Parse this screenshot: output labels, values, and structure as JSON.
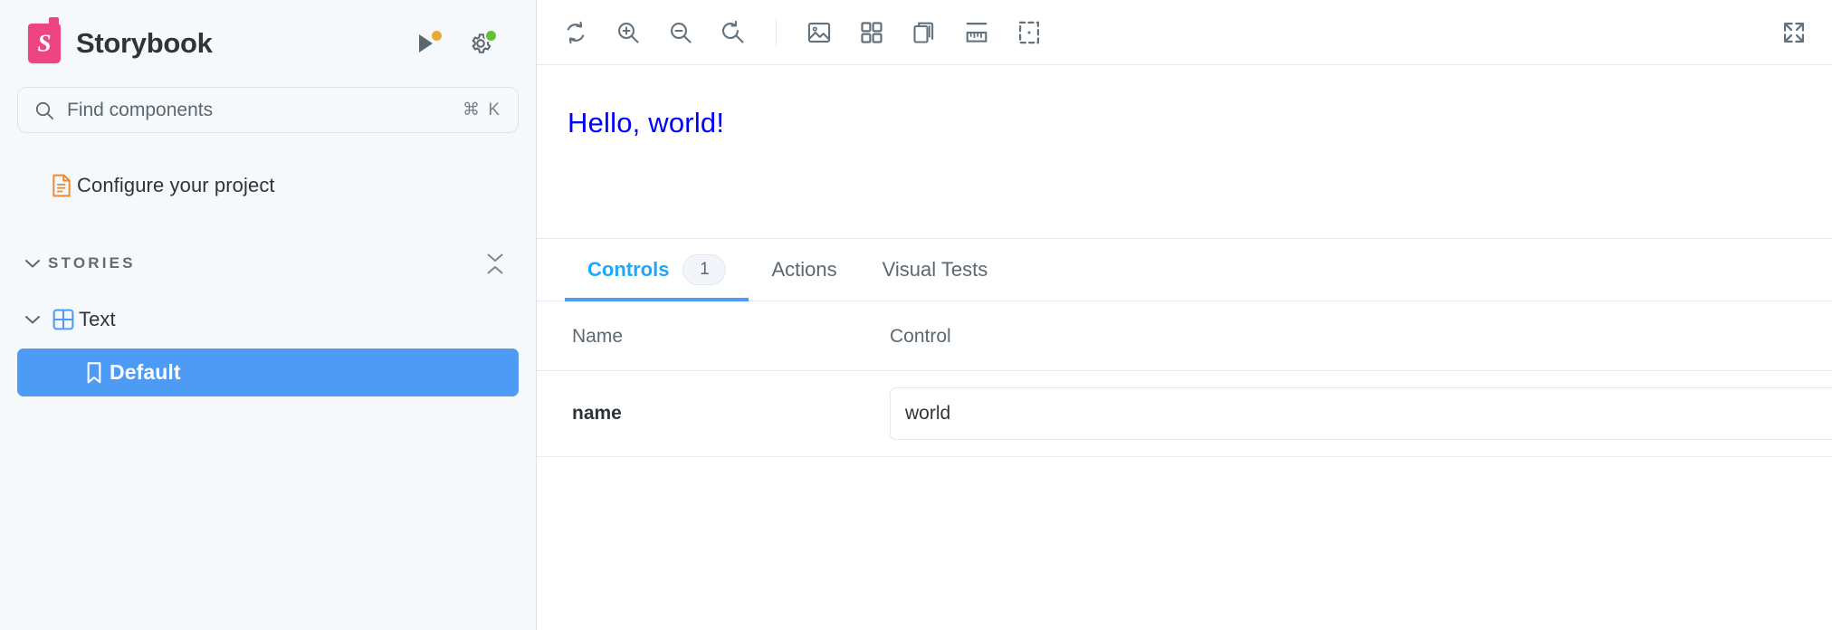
{
  "app": {
    "brand_name": "Storybook",
    "logo_letter": "S"
  },
  "sidebar": {
    "header_actions": [
      {
        "name": "shortcuts-play-button",
        "icon": "play-icon",
        "badge_color": "#eda83a"
      },
      {
        "name": "settings-button",
        "icon": "gear-icon",
        "badge_color": "#66bf3c"
      }
    ],
    "search": {
      "placeholder": "Find components",
      "shortcut": "⌘ K",
      "icon": "search-icon"
    },
    "configure_item": {
      "label": "Configure your project",
      "icon": "document-icon"
    },
    "section": {
      "label": "STORIES",
      "chevron_icon": "chevron-down-icon",
      "collapse_icon": "collapse-all-icon"
    },
    "component": {
      "label": "Text",
      "icon": "component-grid-icon",
      "chevron_icon": "chevron-down-icon"
    },
    "story": {
      "label": "Default",
      "icon": "bookmark-icon",
      "selected": true
    }
  },
  "toolbar": {
    "left_buttons": [
      {
        "name": "remount-button",
        "icon": "reload-icon"
      },
      {
        "name": "zoom-in-button",
        "icon": "zoom-in-icon"
      },
      {
        "name": "zoom-out-button",
        "icon": "zoom-out-icon"
      },
      {
        "name": "zoom-reset-button",
        "icon": "zoom-reset-icon"
      }
    ],
    "addon_buttons": [
      {
        "name": "backgrounds-button",
        "icon": "photo-icon"
      },
      {
        "name": "grid-button",
        "icon": "grid-icon"
      },
      {
        "name": "viewport-button",
        "icon": "copy-layers-icon"
      },
      {
        "name": "measure-button",
        "icon": "ruler-icon"
      },
      {
        "name": "outline-button",
        "icon": "outline-box-icon"
      }
    ],
    "right_buttons": [
      {
        "name": "fullscreen-button",
        "icon": "expand-arrows-icon"
      }
    ]
  },
  "canvas": {
    "preview_text": "Hello, world!",
    "text_color": "#0000ff"
  },
  "panel": {
    "tabs": [
      {
        "label": "Controls",
        "badge": "1",
        "active": true
      },
      {
        "label": "Actions",
        "badge": null,
        "active": false
      },
      {
        "label": "Visual Tests",
        "badge": null,
        "active": false
      }
    ],
    "table": {
      "columns": [
        "Name",
        "Control"
      ],
      "rows": [
        {
          "name": "name",
          "control_value": "world",
          "control_type": "text"
        }
      ]
    }
  },
  "colors": {
    "accent_blue": "#1ea7fd",
    "selected_blue": "#4d9bf4",
    "brand_pink": "#ed4583",
    "sidebar_bg": "#f6f9fc",
    "border": "#e3e9ee",
    "orange_badge": "#eda83a",
    "green_badge": "#66bf3c",
    "doc_orange": "#f1872b"
  }
}
